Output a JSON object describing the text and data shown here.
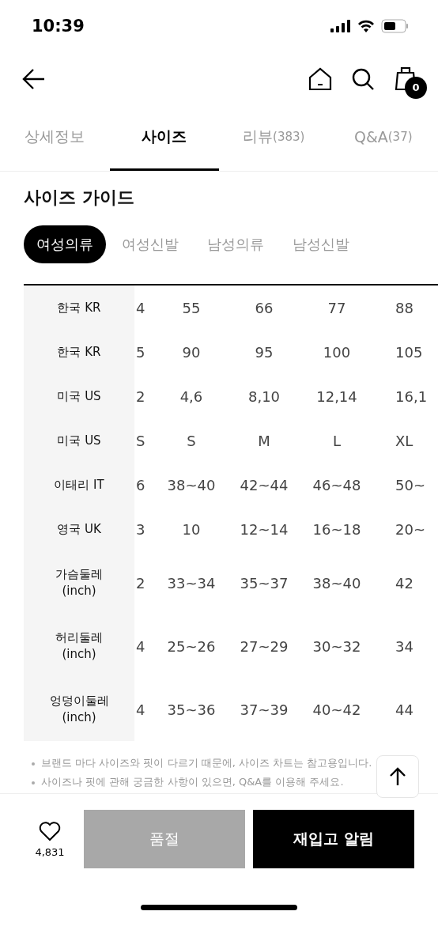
{
  "status_bar": {
    "time": "10:39"
  },
  "header": {
    "cart_count": "0"
  },
  "tabs": [
    {
      "label": "상세정보",
      "selected": false
    },
    {
      "label": "사이즈",
      "selected": true
    },
    {
      "label": "리뷰",
      "count": "(383)",
      "selected": false
    },
    {
      "label": "Q&A",
      "count": "(37)",
      "selected": false
    }
  ],
  "title": "사이즈 가이드",
  "categories": [
    {
      "label": "여성의류",
      "selected": true
    },
    {
      "label": "여성신발",
      "selected": false
    },
    {
      "label": "남성의류",
      "selected": false
    },
    {
      "label": "남성신발",
      "selected": false
    }
  ],
  "size_table": {
    "rows": [
      {
        "label": "한국 KR",
        "cells": [
          "4",
          "55",
          "66",
          "77",
          "88"
        ]
      },
      {
        "label": "한국 KR",
        "cells": [
          "5",
          "90",
          "95",
          "100",
          "105"
        ]
      },
      {
        "label": "미국 US",
        "cells": [
          "2",
          "4,6",
          "8,10",
          "12,14",
          "16,1"
        ]
      },
      {
        "label": "미국 US",
        "cells": [
          "S",
          "S",
          "M",
          "L",
          "XL"
        ]
      },
      {
        "label": "이태리 IT",
        "cells": [
          "6",
          "38~40",
          "42~44",
          "46~48",
          "50~"
        ]
      },
      {
        "label": "영국 UK",
        "cells": [
          "3",
          "10",
          "12~14",
          "16~18",
          "20~"
        ]
      },
      {
        "label": "가슴둘레\n(inch)",
        "cells": [
          "2",
          "33~34",
          "35~37",
          "38~40",
          "42"
        ]
      },
      {
        "label": "허리둘레\n(inch)",
        "cells": [
          "4",
          "25~26",
          "27~29",
          "30~32",
          "34"
        ]
      },
      {
        "label": "엉덩이둘레\n(inch)",
        "cells": [
          "4",
          "35~36",
          "37~39",
          "40~42",
          "44"
        ]
      }
    ]
  },
  "notes": [
    "브랜드 마다 사이즈와 핏이 다르기 때문에, 사이즈 차트는 참고용입니다.",
    "사이즈나 핏에 관해 궁금한 사항이 있으면, Q&A를 이용해 주세요."
  ],
  "bottom_bar": {
    "like_count": "4,831",
    "buttons": [
      {
        "label": "품절",
        "disabled": true
      },
      {
        "label": "재입고 알림",
        "disabled": false
      }
    ]
  }
}
